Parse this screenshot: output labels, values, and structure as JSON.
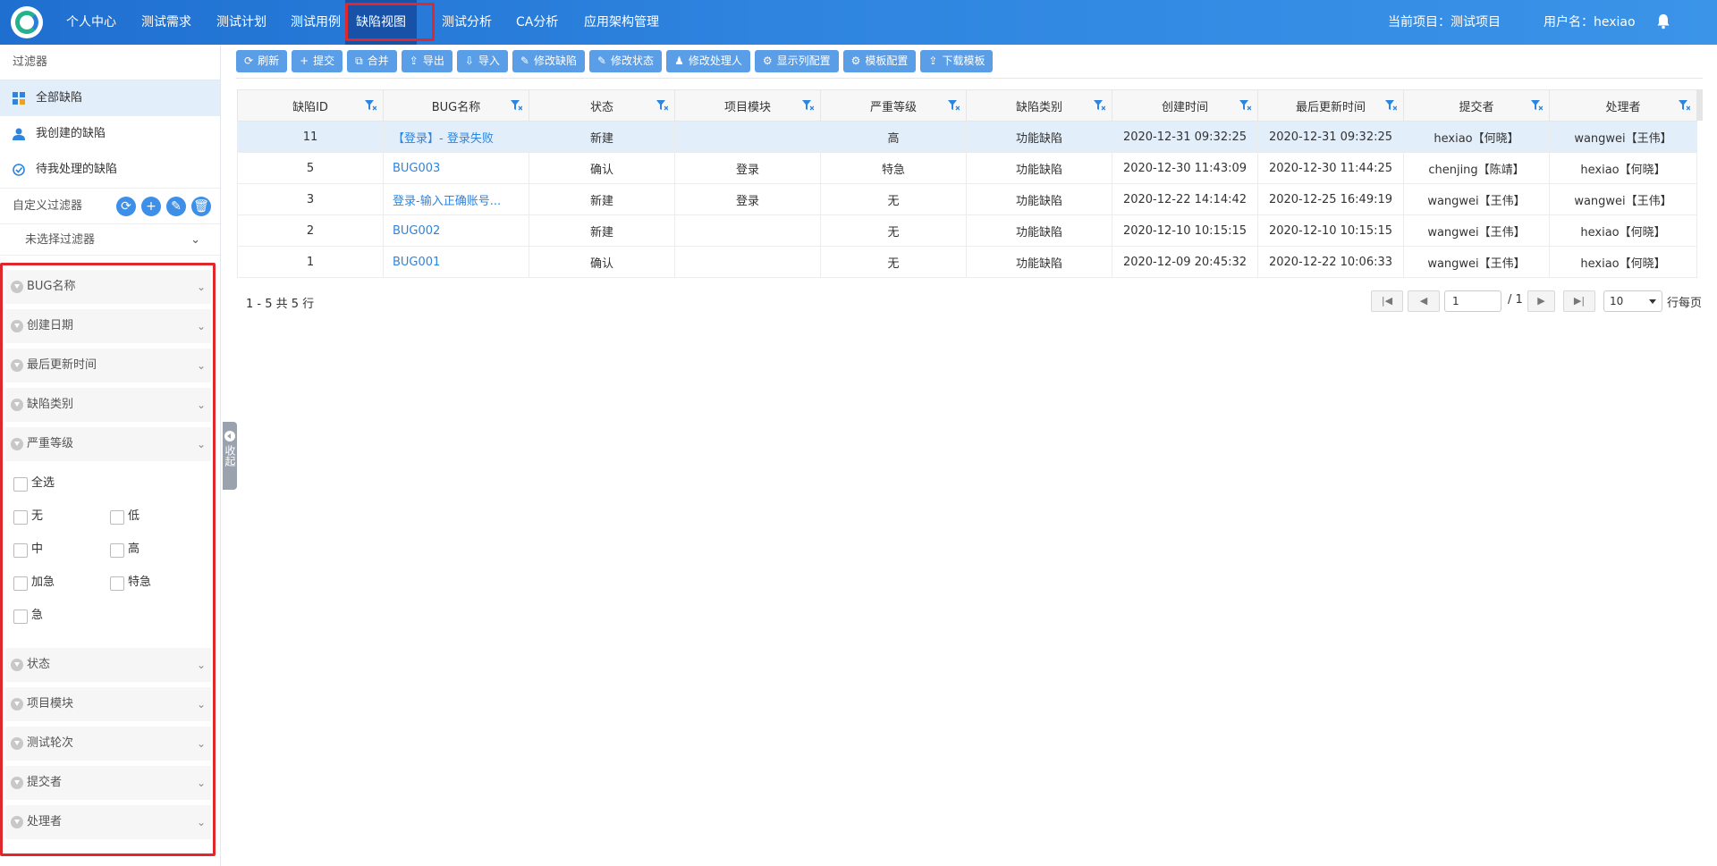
{
  "nav": {
    "items": [
      "个人中心",
      "测试需求",
      "测试计划",
      "测试用例",
      "缺陷视图",
      "测试分析",
      "CA分析",
      "应用架构管理"
    ],
    "active_index": 4,
    "project": "当前项目：测试项目",
    "user": "用户名：hexiao"
  },
  "sidebar": {
    "title": "过滤器",
    "items": [
      {
        "label": "全部缺陷",
        "icon": "grid-icon"
      },
      {
        "label": "我创建的缺陷",
        "icon": "user-icon"
      },
      {
        "label": "待我处理的缺陷",
        "icon": "task-icon"
      }
    ],
    "custom_filter_label": "自定义过滤器",
    "custom_filter_select": "未选择过滤器",
    "filters": [
      "BUG名称",
      "创建日期",
      "最后更新时间",
      "缺陷类别",
      "严重等级",
      "状态",
      "项目模块",
      "测试轮次",
      "提交者",
      "处理者"
    ],
    "severity_options": [
      "全选",
      "无",
      "低",
      "中",
      "高",
      "加急",
      "特急",
      "急"
    ],
    "collapse_label": "收起"
  },
  "toolbar": [
    "刷新",
    "提交",
    "合并",
    "导出",
    "导入",
    "修改缺陷",
    "修改状态",
    "修改处理人",
    "显示列配置",
    "模板配置",
    "下载模板"
  ],
  "table": {
    "columns": [
      "缺陷ID",
      "BUG名称",
      "状态",
      "项目模块",
      "严重等级",
      "缺陷类别",
      "创建时间",
      "最后更新时间",
      "提交者",
      "处理者"
    ],
    "rows": [
      [
        "11",
        "【登录】- 登录失败",
        "新建",
        "",
        "高",
        "功能缺陷",
        "2020-12-31 09:32:25",
        "2020-12-31 09:32:25",
        "hexiao【何晓】",
        "wangwei【王伟】"
      ],
      [
        "5",
        "BUG003",
        "确认",
        "登录",
        "特急",
        "功能缺陷",
        "2020-12-30 11:43:09",
        "2020-12-30 11:44:25",
        "chenjing【陈靖】",
        "hexiao【何晓】"
      ],
      [
        "3",
        "登录-输入正确账号...",
        "新建",
        "登录",
        "无",
        "功能缺陷",
        "2020-12-22 14:14:42",
        "2020-12-25 16:49:19",
        "wangwei【王伟】",
        "wangwei【王伟】"
      ],
      [
        "2",
        "BUG002",
        "新建",
        "",
        "无",
        "功能缺陷",
        "2020-12-10 10:15:15",
        "2020-12-10 10:15:15",
        "wangwei【王伟】",
        "hexiao【何晓】"
      ],
      [
        "1",
        "BUG001",
        "确认",
        "",
        "无",
        "功能缺陷",
        "2020-12-09 20:45:32",
        "2020-12-22 10:06:33",
        "wangwei【王伟】",
        "hexiao【何晓】"
      ]
    ],
    "selected_row": 0
  },
  "pager": {
    "info": "1 - 5 共 5 行",
    "page": "1",
    "total": "/ 1",
    "page_size": "10",
    "per_page_label": "行每页"
  },
  "colors": {
    "accent": "#2e84df",
    "link": "#2d85e0",
    "highlight": "#e3eefb",
    "annotation": "#e0272b"
  }
}
